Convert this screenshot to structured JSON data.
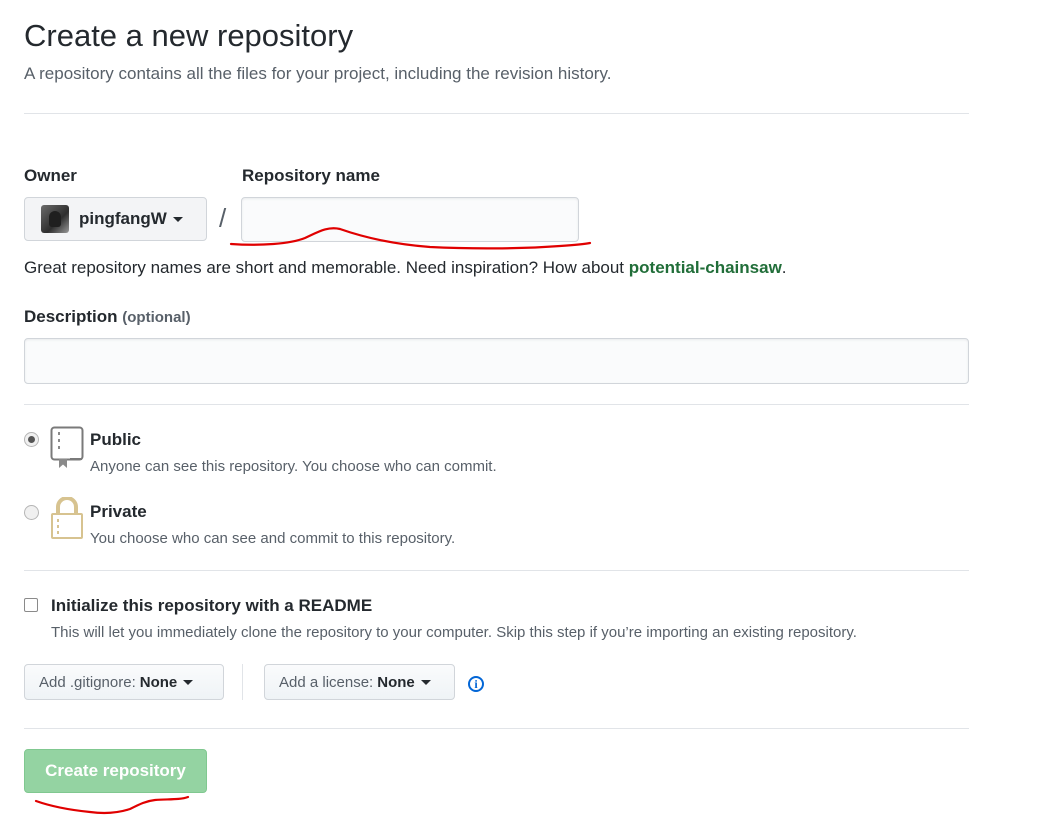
{
  "header": {
    "title": "Create a new repository",
    "subtitle": "A repository contains all the files for your project, including the revision history."
  },
  "owner": {
    "label": "Owner",
    "name": "pingfangW"
  },
  "repository": {
    "label": "Repository name",
    "slash": "/",
    "value": "",
    "hint_prefix": "Great repository names are short and memorable. Need inspiration? How about ",
    "suggestion": "potential-chainsaw",
    "hint_suffix": "."
  },
  "description": {
    "label": "Description",
    "optional": "(optional)",
    "value": ""
  },
  "visibility": {
    "selected": "public",
    "public": {
      "title": "Public",
      "desc": "Anyone can see this repository. You choose who can commit.",
      "icon": "repo-book-icon"
    },
    "private": {
      "title": "Private",
      "desc": "You choose who can see and commit to this repository.",
      "icon": "lock-icon"
    }
  },
  "readme": {
    "checked": false,
    "title": "Initialize this repository with a README",
    "desc": "This will let you immediately clone the repository to your computer. Skip this step if you’re importing an existing repository."
  },
  "gitignore": {
    "prefix": "Add .gitignore:",
    "value": "None"
  },
  "license": {
    "prefix": "Add a license:",
    "value": "None"
  },
  "info_icon": "info-icon",
  "submit": {
    "label": "Create repository",
    "enabled": false
  },
  "colors": {
    "suggestion": "#216e39",
    "create_button": "#94d3a2",
    "annotation": "#e00000",
    "info": "#0366d6"
  }
}
